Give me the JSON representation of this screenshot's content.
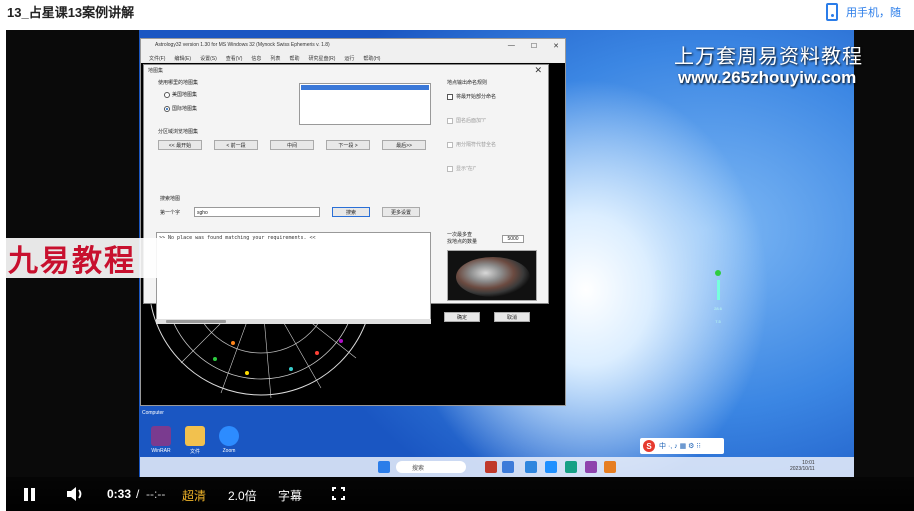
{
  "page": {
    "title": "13_占星课13案例讲解",
    "phone_link": "用手机，随"
  },
  "watermark": {
    "line1": "上万套周易资料教程",
    "line2": "www.265zhouyiw.com"
  },
  "brand": {
    "text": "九易教程"
  },
  "app": {
    "title": "Astrology32 version 1.30 for MS Windows 32 (Mynock Swiss Ephemeris v. 1.8)",
    "menu": [
      "文件(F)",
      "编辑(E)",
      "设置(S)",
      "查看(V)",
      "信息",
      "列表",
      "帮助",
      "研究星盘(R)",
      "运行",
      "帮助(H)"
    ],
    "window_controls": [
      "—",
      "☐",
      "✕"
    ]
  },
  "dialog": {
    "title": "地图集",
    "close": "✕",
    "group_atlas": "使用哪里的地图集",
    "radio_us": "美国地图集",
    "radio_intl": "国际地图集",
    "group_paging": "分区域浏览地图集",
    "btn_first": "<< 最开始",
    "btn_prev": "< 前一段",
    "btn_mid": "中间",
    "btn_next": "下一段 >",
    "btn_last": "最后>>",
    "search_group": "搜索地图",
    "first_char_label": "第一个字",
    "search_value": "sgho",
    "btn_search": "搜索",
    "btn_more": "更多设置",
    "output_text": ">> No place was found matching your requirements. <<",
    "right_group": "地点输出命名规则",
    "chk_state": "将最开始部分命名",
    "chk_1": "国名后面加\"/\"",
    "chk_2": "用分隔符代替全名",
    "chk_3": "显示\"在/\"",
    "sample_label1": "一次最多查",
    "sample_label2": "找地点的数量",
    "sample_value": "5000",
    "btn_ok": "确定",
    "btn_cancel": "取消"
  },
  "desktop_icons": [
    {
      "label": "WinRAR",
      "color": "#7a3b8f"
    },
    {
      "label": "文件",
      "color": "#f2c14e"
    },
    {
      "label": "Zoom",
      "color": "#2d8cff"
    }
  ],
  "desktop_label": "Computer",
  "taskbar": {
    "search_placeholder": "搜索",
    "clock_time": "10:01",
    "clock_date": "2023/10/11"
  },
  "ime": {
    "logo": "S",
    "text": "中 ·, ♪ ▦ ⚙ ⁝⁝"
  },
  "side_widget": {
    "val1": "28.6",
    "val2": "7.5"
  },
  "controls": {
    "time": "0:33",
    "separator": "/",
    "duration": "--:--",
    "quality": "超清",
    "speed": "2.0倍",
    "subtitle": "字幕"
  }
}
